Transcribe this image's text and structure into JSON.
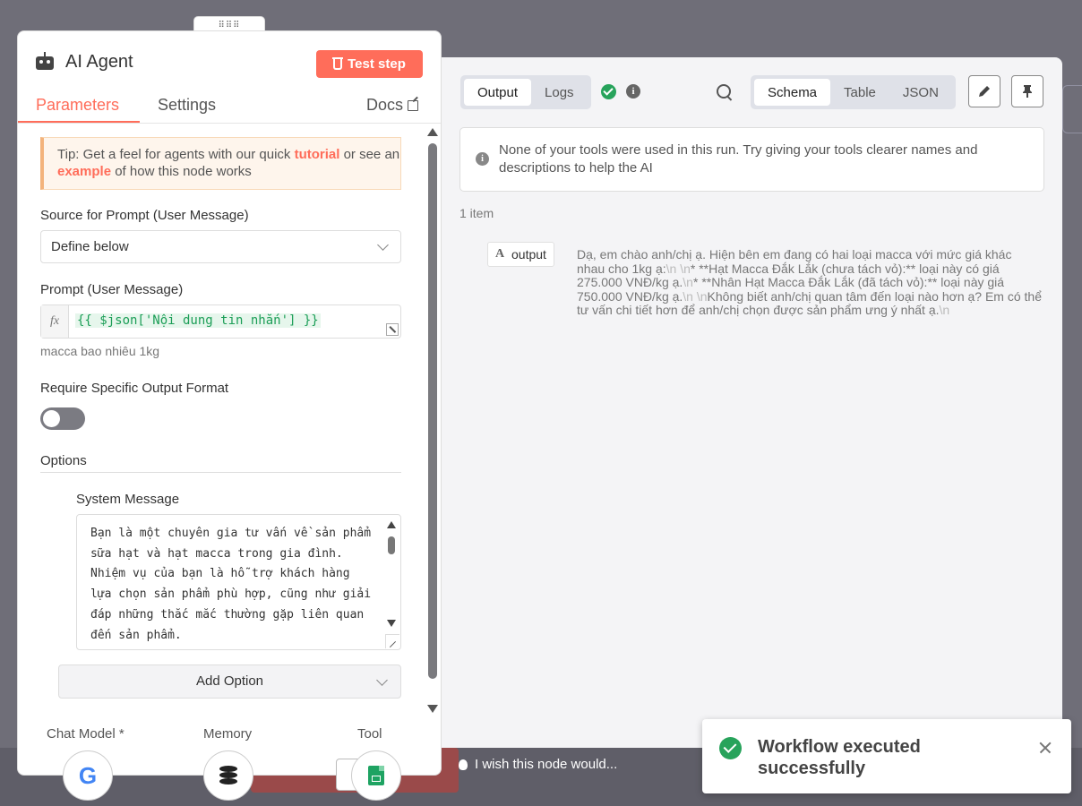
{
  "node": {
    "title": "AI Agent",
    "test_step_label": "Test step",
    "tabs": [
      {
        "label": "Parameters",
        "active": true
      },
      {
        "label": "Settings",
        "active": false
      }
    ],
    "docs_label": "Docs"
  },
  "tip": {
    "prefix": "Tip: Get a feel for agents with our quick ",
    "link1": "tutorial",
    "middle": " or see an ",
    "link2": "example",
    "suffix": " of how this node works"
  },
  "fields": {
    "source_label": "Source for Prompt (User Message)",
    "source_value": "Define below",
    "prompt_label": "Prompt (User Message)",
    "prompt_expression": "{{ $json['Nội dung tin nhắn'] }}",
    "prompt_preview": "macca bao nhiêu 1kg",
    "require_format_label": "Require Specific Output Format",
    "require_format_enabled": false,
    "options_label": "Options",
    "system_message_label": "System Message",
    "system_message_value": "Bạn là một chuyên gia tư vấn về sản phẩm sữa hạt và hạt macca trong gia đình. Nhiệm vụ của bạn là hỗ trợ khách hàng lựa chọn sản phẩm phù hợp, cũng như giải đáp những thắc mắc thường gặp liên quan đến sản phẩm.",
    "add_option_label": "Add Option"
  },
  "connections": {
    "chat_model_label": "Chat Model *",
    "memory_label": "Memory",
    "tool_label": "Tool",
    "chat_model_icon": "google-icon",
    "memory_icon": "database-icon",
    "tool_icon": "google-sheets-icon"
  },
  "output": {
    "tabs": [
      {
        "label": "Output",
        "active": true
      },
      {
        "label": "Logs",
        "active": false
      }
    ],
    "views": [
      {
        "label": "Schema",
        "active": true
      },
      {
        "label": "Table",
        "active": false
      },
      {
        "label": "JSON",
        "active": false
      }
    ],
    "notice": "None of your tools were used in this run. Try giving your tools clearer names and descriptions to help the AI",
    "item_count": "1 item",
    "key_type": "A",
    "key": "output",
    "value_parts": [
      {
        "t": "Dạ, em chào anh/chị ạ. Hiện bên em đang có hai loại macca với mức giá khác nhau cho 1kg ạ:",
        "nl": false
      },
      {
        "t": "\\n \\n",
        "nl": true
      },
      {
        "t": "* **Hạt Macca Đắk Lắk (chưa tách vỏ):** loại này có giá 275.000 VNĐ/kg ạ.",
        "nl": false
      },
      {
        "t": "\\n",
        "nl": true
      },
      {
        "t": "* **Nhân Hạt Macca Đắk Lắk (đã tách vỏ):** loại này giá 750.000 VNĐ/kg ạ.",
        "nl": false
      },
      {
        "t": "\\n \\n",
        "nl": true
      },
      {
        "t": "Không biết anh/chị quan tâm đến loại nào hơn ạ? Em có thể tư vấn chi tiết hơn để anh/chị chọn được sản phẩm ưng ý nhất ạ.",
        "nl": false
      },
      {
        "t": "\\n",
        "nl": true
      }
    ]
  },
  "footer": {
    "wish_label": "I wish this node would..."
  },
  "toast": {
    "message": "Workflow executed successfully"
  },
  "colors": {
    "accent": "#ff6d5a",
    "success": "#27a35b"
  }
}
